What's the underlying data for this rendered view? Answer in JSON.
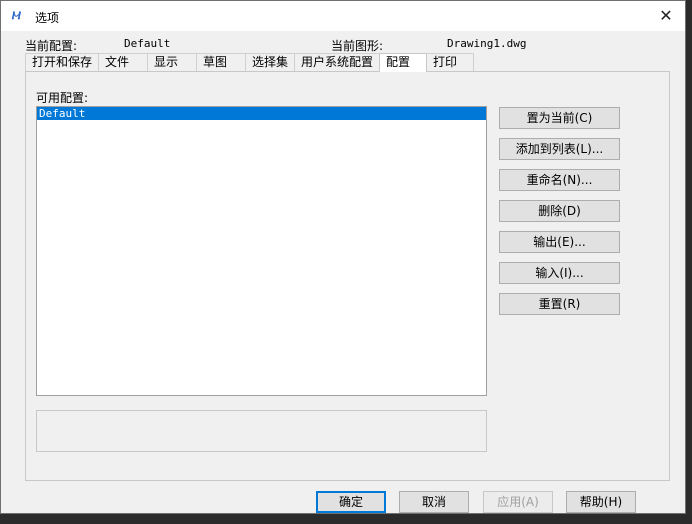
{
  "window": {
    "title": "选项",
    "app_icon_glyph": "Ⲙ",
    "close_glyph": "✕"
  },
  "info": {
    "current_profile_label": "当前配置:",
    "current_profile_value": "Default",
    "current_drawing_label": "当前图形:",
    "current_drawing_value": "Drawing1.dwg"
  },
  "tabs": [
    {
      "label": "打开和保存"
    },
    {
      "label": "文件"
    },
    {
      "label": "显示"
    },
    {
      "label": "草图"
    },
    {
      "label": "选择集"
    },
    {
      "label": "用户系统配置"
    },
    {
      "label": "配置",
      "active": true
    },
    {
      "label": "打印"
    }
  ],
  "profiles": {
    "label": "可用配置:",
    "items": [
      "Default"
    ],
    "selected_color": "#0078d7"
  },
  "side_buttons": [
    {
      "label": "置为当前(C)"
    },
    {
      "label": "添加到列表(L)..."
    },
    {
      "label": "重命名(N)..."
    },
    {
      "label": "删除(D)"
    },
    {
      "label": "输出(E)..."
    },
    {
      "label": "输入(I)..."
    },
    {
      "label": "重置(R)"
    }
  ],
  "footer": {
    "ok": "确定",
    "cancel": "取消",
    "apply": "应用(A)",
    "help": "帮助(H)"
  }
}
